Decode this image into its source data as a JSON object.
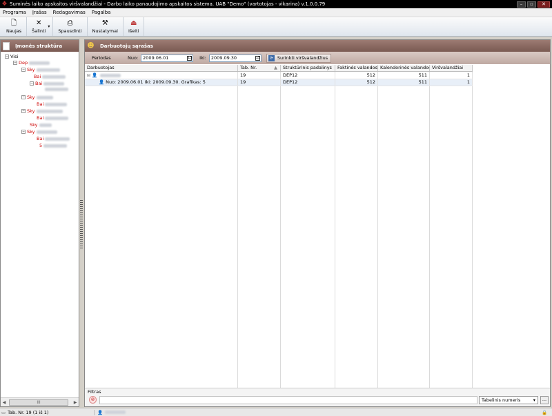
{
  "window": {
    "title": "Suminės laiko apskaitos viršvalandžiai - Darbo laiko panaudojimo apskaitos sistema. UAB \"Demo\" (vartotojas - vikarina) v.1.0.0.79"
  },
  "menu": [
    "Programa",
    "Įrašas",
    "Redagavimas",
    "Pagalba"
  ],
  "toolbar": {
    "new": "Naujas",
    "delete": "Šalinti",
    "print": "Spausdinti",
    "settings": "Nustatymai",
    "exit": "Išeiti"
  },
  "left_panel": {
    "title": "Įmonės struktūra",
    "tree": [
      {
        "label": "Visi"
      },
      {
        "label": "Dep"
      },
      {
        "label": "Sky"
      },
      {
        "label": "Bai"
      },
      {
        "label": "Bai"
      },
      {
        "label": "Sky"
      },
      {
        "label": "Bai"
      },
      {
        "label": "Sky"
      },
      {
        "label": "Bai"
      },
      {
        "label": "Sky"
      },
      {
        "label": "Sky"
      },
      {
        "label": "Bai"
      },
      {
        "label": "5"
      }
    ],
    "scroll_label": "III"
  },
  "right_panel": {
    "title": "Darbuotojų sąrašas",
    "period": {
      "label": "Periodas",
      "from_label": "Nuo:",
      "from": "2009.06.01",
      "to_label": "Iki:",
      "to": "2009.09.30",
      "collect_button": "Surinkti viršvalandžius"
    },
    "columns": [
      "Darbuotojas",
      "Tab. Nr.",
      "Struktūrinis padalinys",
      "Faktinės valandos",
      "Kalendorinės valandos",
      "Viršvalandžiai"
    ],
    "rows": [
      {
        "employee": "",
        "tab_nr": "19",
        "unit": "DEP12",
        "actual": "512",
        "calendar": "511",
        "overtime": "1"
      },
      {
        "employee": "Nuo: 2009.06.01 Iki: 2009.09.30. Grafikas: 5",
        "tab_nr": "19",
        "unit": "DEP12",
        "actual": "512",
        "calendar": "511",
        "overtime": "1"
      }
    ],
    "filter": {
      "label": "Filtras",
      "field": "Tabelinis numeris",
      "more": "..."
    }
  },
  "status": {
    "record": "Tab. Nr. 19 (1 iš 1)"
  }
}
